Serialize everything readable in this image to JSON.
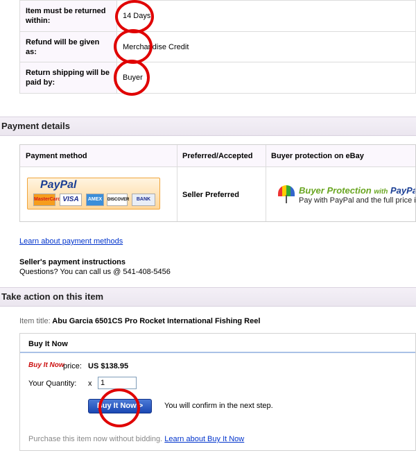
{
  "return_policy": {
    "rows": [
      {
        "label": "Item must be returned within:",
        "value": "14 Days"
      },
      {
        "label": "Refund will be given as:",
        "value": "Merchandise Credit"
      },
      {
        "label": "Return shipping will be paid by:",
        "value": "Buyer"
      }
    ]
  },
  "payment": {
    "section_title": "Payment details",
    "columns": [
      "Payment method",
      "Preferred/Accepted",
      "Buyer protection on eBay"
    ],
    "paypal_logo": "PayPal",
    "cards": [
      "MasterCard",
      "VISA",
      "AMEX",
      "DISCOVER",
      "BANK"
    ],
    "preferred": "Seller Preferred",
    "protection_title": "Buyer Protection",
    "protection_with": "with",
    "protection_brand": "PayPal",
    "protection_sub": "Pay with PayPal and the full price is co",
    "learn_link": "Learn about payment methods",
    "instructions_title": "Seller's payment instructions",
    "instructions_body": "Questions? You can call us @ 541-408-5456"
  },
  "action": {
    "section_title": "Take action on this item",
    "item_title_label": "Item title:",
    "item_title": "Abu Garcia 6501CS Pro Rocket International Fishing Reel",
    "box_title": "Buy It Now",
    "bin_logo": "Buy It Now",
    "price_label": "price:",
    "price": "US $138.95",
    "quantity_label": "Your Quantity:",
    "quantity_x": "x",
    "quantity_value": "1",
    "button_label": "Buy It Now >",
    "confirm_note": "You will confirm in the next step.",
    "footer_text": "Purchase this item now without bidding.",
    "footer_link": "Learn about Buy It Now"
  },
  "annotation_color": "#e00000"
}
